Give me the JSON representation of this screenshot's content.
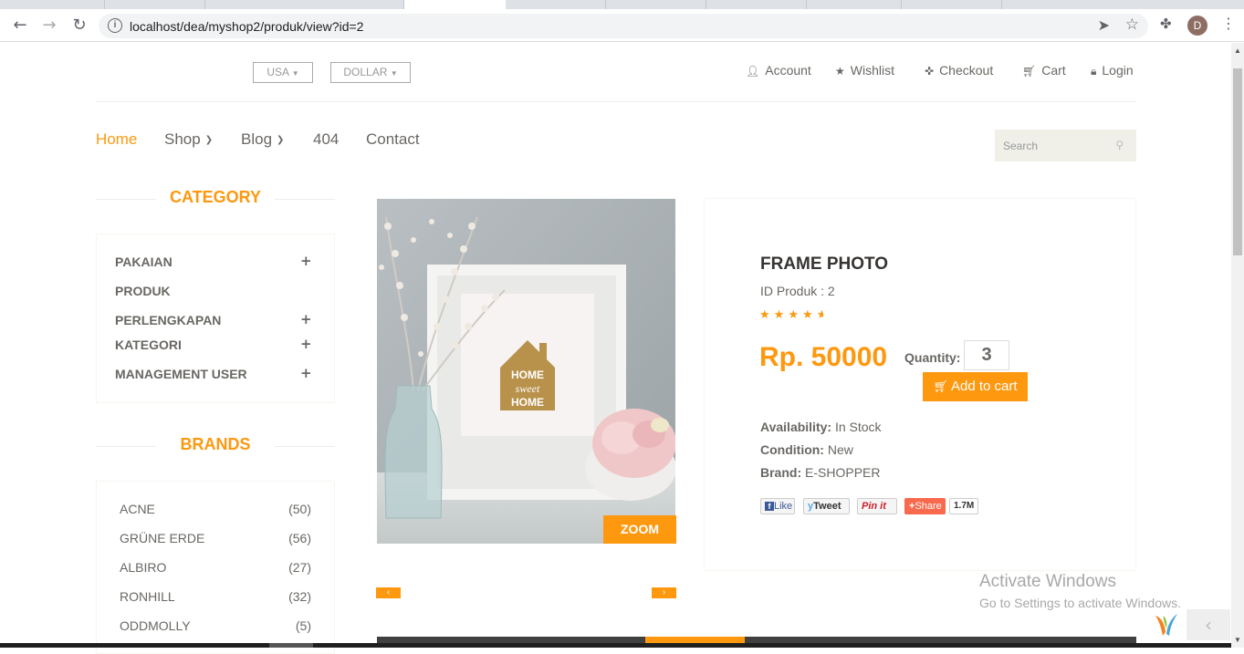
{
  "browser": {
    "url": "localhost/dea/myshop2/produk/view?id=2",
    "back_glyph": "←",
    "forward_glyph": "→",
    "reload_glyph": "↻",
    "avatar_letter": "D"
  },
  "header": {
    "country_select": "USA",
    "currency_select": "DOLLAR",
    "links": {
      "account": "Account",
      "wishlist": "Wishlist",
      "checkout": "Checkout",
      "cart": "Cart",
      "login": "Login"
    }
  },
  "nav": {
    "home": "Home",
    "shop": "Shop",
    "blog": "Blog",
    "notfound": "404",
    "contact": "Contact",
    "search_placeholder": "Search"
  },
  "sidebar": {
    "category_title": "CATEGORY",
    "categories": [
      {
        "label": "PAKAIAN",
        "expand": "+"
      },
      {
        "label": "PRODUK",
        "expand": ""
      },
      {
        "label": "PERLENGKAPAN",
        "expand": "+"
      },
      {
        "label": "KATEGORI",
        "expand": "+"
      },
      {
        "label": "MANAGEMENT USER",
        "expand": "+"
      }
    ],
    "brands_title": "BRANDS",
    "brands": [
      {
        "name": "ACNE",
        "count": "(50)"
      },
      {
        "name": "GRÜNE ERDE",
        "count": "(56)"
      },
      {
        "name": "ALBIRO",
        "count": "(27)"
      },
      {
        "name": "RONHILL",
        "count": "(32)"
      },
      {
        "name": "ODDMOLLY",
        "count": "(5)"
      }
    ]
  },
  "product": {
    "image_text": [
      "HOME",
      "sweet",
      "HOME"
    ],
    "zoom_label": "ZOOM",
    "prev_arrow": "‹",
    "next_arrow": "›",
    "title": "FRAME PHOTO",
    "id_text": "ID Produk : 2",
    "rating": 4.5,
    "price": "Rp. 50000",
    "quantity_label": "Quantity:",
    "quantity_value": "3",
    "add_to_cart": "Add to cart",
    "availability_label": "Availability:",
    "availability": "In Stock",
    "condition_label": "Condition:",
    "condition": "New",
    "brand_label": "Brand:",
    "brand": "E-SHOPPER",
    "share": {
      "like": "Like",
      "tweet": "Tweet",
      "pin": "Pin it",
      "share": "Share",
      "count": "1.7M"
    }
  },
  "overlay": {
    "activate_title": "Activate Windows",
    "activate_sub": "Go to Settings to activate Windows."
  },
  "colors": {
    "accent": "#fe980f",
    "text": "#696763",
    "dark": "#363432"
  }
}
